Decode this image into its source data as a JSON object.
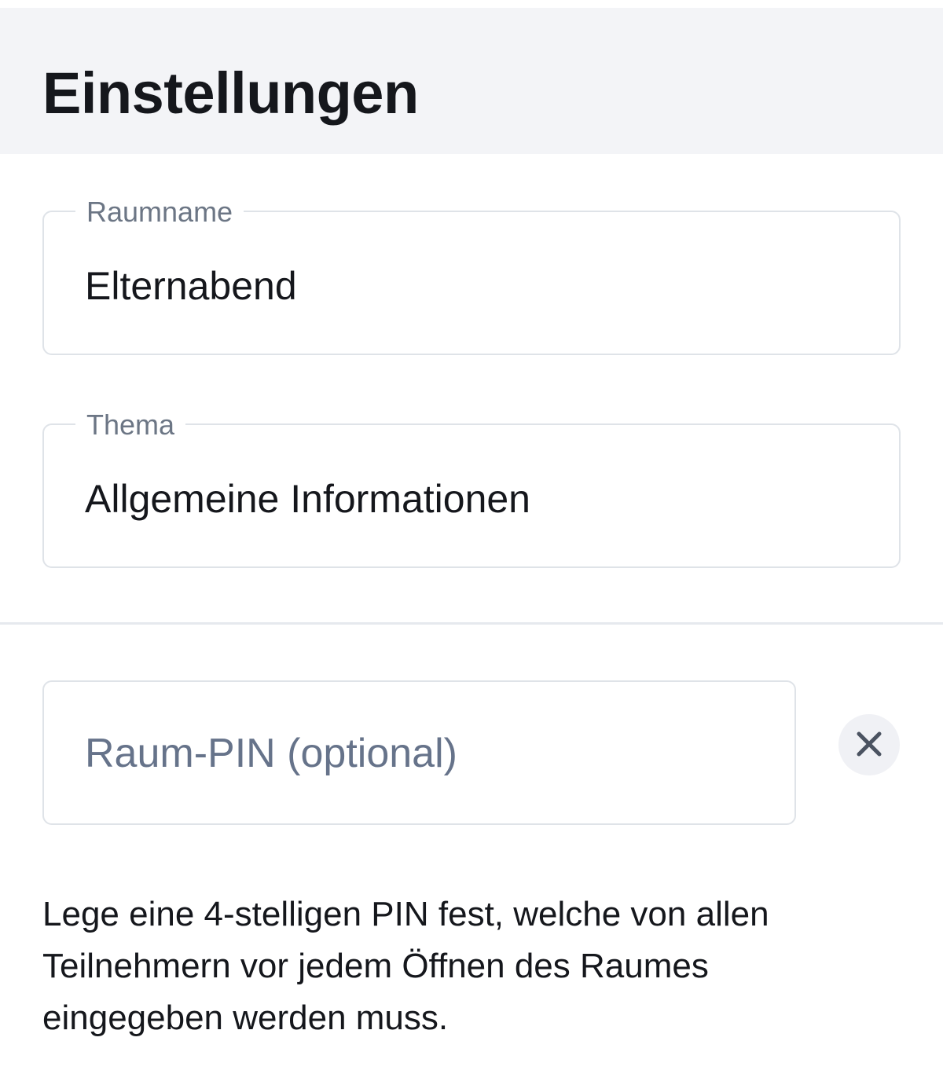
{
  "header": {
    "title": "Einstellungen"
  },
  "form": {
    "room_name": {
      "label": "Raumname",
      "value": "Elternabend"
    },
    "topic": {
      "label": "Thema",
      "value": "Allgemeine Informationen"
    },
    "room_pin": {
      "placeholder": "Raum-PIN (optional)",
      "clear_icon": "close-icon",
      "help_text": "Lege eine 4-stelligen PIN fest, welche von allen Teilnehmern vor jedem Öffnen des Raumes eingegeben werden muss."
    }
  },
  "colors": {
    "header_background": "#f3f4f7",
    "border": "#dfe3e8",
    "label": "#6c7685",
    "placeholder": "#66738a",
    "text": "#15171c"
  }
}
